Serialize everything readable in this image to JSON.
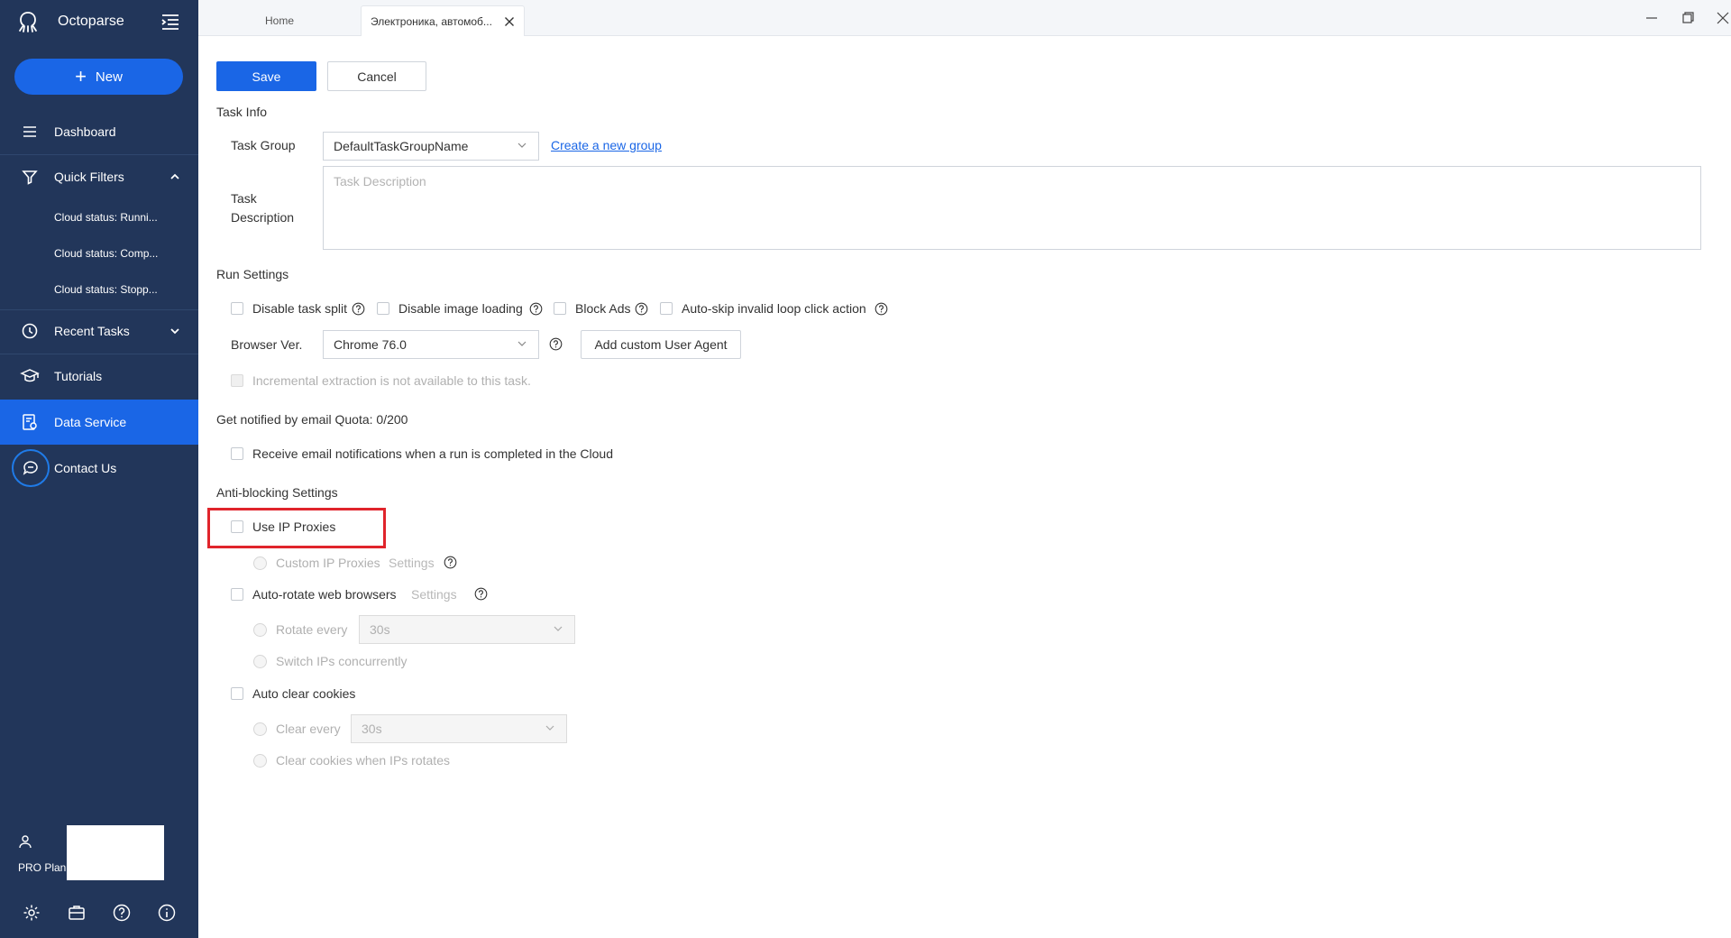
{
  "app": {
    "name": "Octoparse"
  },
  "sidebar": {
    "new_label": "New",
    "dashboard": "Dashboard",
    "quick_filters": "Quick Filters",
    "filters": [
      "Cloud status: Runni...",
      "Cloud status: Comp...",
      "Cloud status: Stopp..."
    ],
    "recent_tasks": "Recent Tasks",
    "tutorials": "Tutorials",
    "data_service": "Data Service",
    "contact_us": "Contact Us",
    "plan": "PRO Plan"
  },
  "tabs": {
    "home": "Home",
    "active": "Электроника, автомоб..."
  },
  "toolbar": {
    "save_label": "Save",
    "cancel_label": "Cancel"
  },
  "task_info": {
    "title": "Task Info",
    "task_group_label": "Task Group",
    "task_group_value": "DefaultTaskGroupName",
    "create_group_link": "Create a new group",
    "description_label_1": "Task",
    "description_label_2": "Description",
    "description_placeholder": "Task Description"
  },
  "run_settings": {
    "title": "Run Settings",
    "disable_task_split": "Disable task split",
    "disable_image_loading": "Disable image loading",
    "block_ads": "Block Ads",
    "auto_skip": "Auto-skip invalid loop click action",
    "browser_ver_label": "Browser Ver.",
    "browser_ver_value": "Chrome 76.0",
    "add_user_agent": "Add custom User Agent",
    "incremental_note": "Incremental extraction is not available to this task."
  },
  "notify": {
    "title": "Get notified by email Quota: 0/200",
    "receive_email": "Receive email notifications when a run is completed in the Cloud"
  },
  "anti_blocking": {
    "title": "Anti-blocking Settings",
    "use_ip_proxies": "Use IP Proxies",
    "custom_ip_proxies": "Custom IP Proxies",
    "settings": "Settings",
    "auto_rotate": "Auto-rotate web browsers",
    "rotate_every": "Rotate every",
    "rotate_value": "30s",
    "switch_ips": "Switch IPs concurrently",
    "auto_clear": "Auto clear cookies",
    "clear_every": "Clear every",
    "clear_value": "30s",
    "clear_when_rotates": "Clear cookies when IPs rotates"
  },
  "colors": {
    "sidebar": "#22365a",
    "accent": "#1a66e6",
    "highlight": "#e0242b"
  }
}
